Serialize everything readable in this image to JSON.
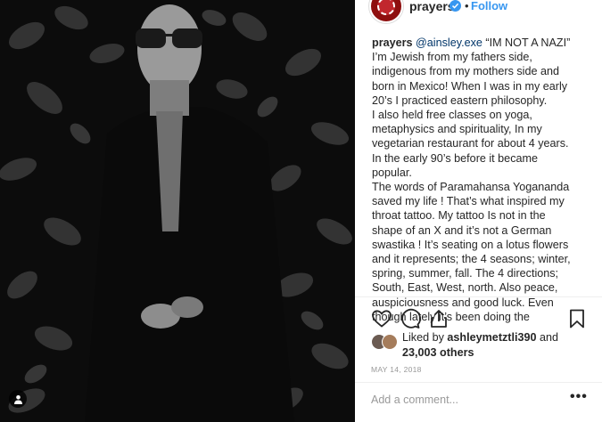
{
  "post": {
    "username": "prayers",
    "verified": true,
    "separator": "•",
    "follow_label": "Follow",
    "caption_username": "prayers",
    "caption_mention": "@ainsley.exe",
    "caption_text": " “IM NOT A NAZI”\nI’m Jewish from my fathers side,\nindigenous from my mothers side and\nborn in Mexico! When I was in my early\n20’s I practiced eastern philosophy.\nI also held free classes on yoga,\nmetaphysics and spirituality, In my\nvegetarian restaurant for about 4 years.\nIn the early 90’s before it became\npopular.\nThe words of Paramahansa Yogananda\nsaved my life ! That’s what inspired my\nthroat tattoo. My tattoo Is not in the\nshape of an X and it’s not a German\nswastika ! It’s seating on a lotus flowers\nand it represents; the 4 seasons; winter,\nspring, summer, fall. The 4 directions;\nSouth, East, West, north. Also peace,\nauspiciousness and good luck. Even\nthough lately it’s been doing the",
    "liked_by_prefix": "Liked by ",
    "liked_by_user": "ashleymetztli390",
    "liked_by_and": " and",
    "likes_count": "23,003 others",
    "date": "MAY 14, 2018",
    "comment_placeholder": "Add a comment...",
    "more_label": "•••"
  },
  "icons": {
    "like": "heart-icon",
    "comment": "comment-icon",
    "share": "share-icon",
    "save": "bookmark-icon",
    "tag": "person-tag-icon"
  },
  "colors": {
    "link": "#3897f0",
    "mention": "#003569",
    "muted": "#999999",
    "text": "#262626"
  }
}
